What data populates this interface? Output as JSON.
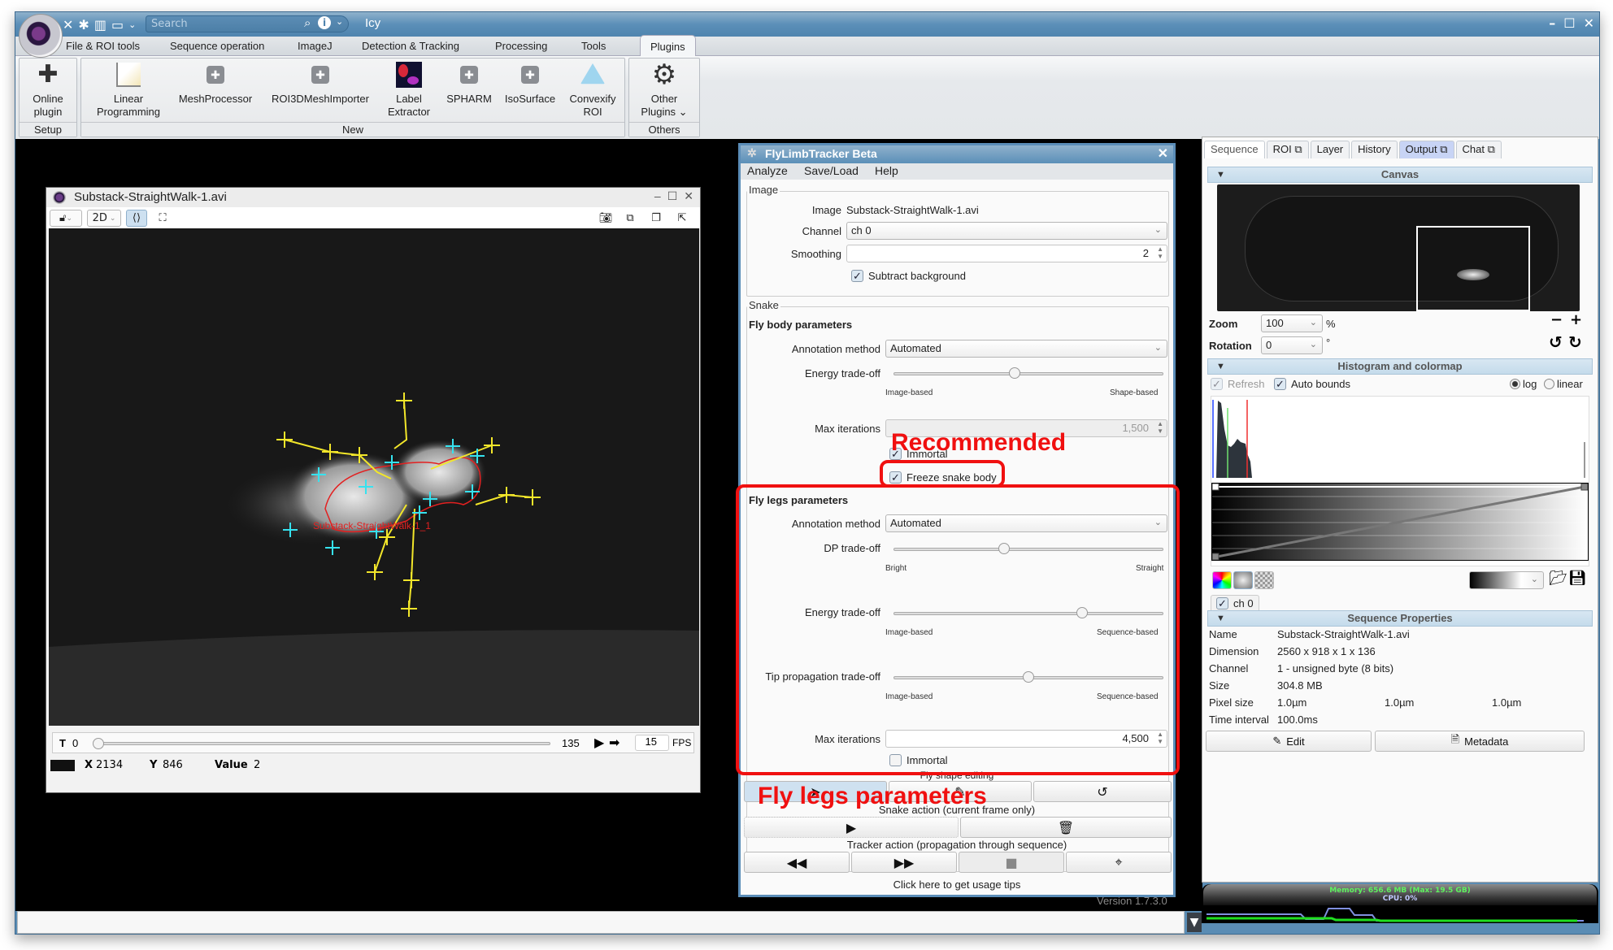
{
  "app": {
    "title": "Icy",
    "search_placeholder": "Search",
    "quick_icons": [
      "tools-icon",
      "plugin-icon",
      "layout-icon",
      "window-icon"
    ],
    "window_controls": [
      "minimize-icon",
      "maximize-icon",
      "close-icon"
    ]
  },
  "menu": {
    "items": [
      "File & ROI tools",
      "Sequence operation",
      "ImageJ",
      "Detection & Tracking",
      "Processing",
      "Tools",
      "Plugins"
    ],
    "active": "Plugins"
  },
  "ribbon": {
    "groups": [
      {
        "label": "Setup",
        "buttons": [
          {
            "label1": "Online",
            "label2": "plugin",
            "icon": "puzzle-icon"
          }
        ]
      },
      {
        "label": "New",
        "buttons": [
          {
            "label1": "Linear",
            "label2": "Programming",
            "icon": "chart-icon"
          },
          {
            "label1": "MeshProcessor",
            "label2": "",
            "icon": "puzzle-icon"
          },
          {
            "label1": "ROI3DMeshImporter",
            "label2": "",
            "icon": "puzzle-icon"
          },
          {
            "label1": "Label",
            "label2": "Extractor",
            "icon": "label-icon"
          },
          {
            "label1": "SPHARM",
            "label2": "",
            "icon": "puzzle-icon"
          },
          {
            "label1": "IsoSurface",
            "label2": "",
            "icon": "puzzle-icon"
          },
          {
            "label1": "Convexify",
            "label2": "ROI",
            "icon": "triangle-icon"
          }
        ]
      },
      {
        "label": "Others",
        "buttons": [
          {
            "label1": "Other",
            "label2": "Plugins ⌄",
            "icon": "gear-icon"
          }
        ]
      }
    ]
  },
  "viewer": {
    "title": "Substack-StraightWalk-1.avi",
    "mode": "2D",
    "roi_label": "Substack-StraightWalk-1_1",
    "t_label": "T",
    "t_value": "0",
    "t_max": "135",
    "t_fraction": 0.0,
    "fps": "15",
    "fps_label": "FPS",
    "x_label": "X",
    "x_value": "2134",
    "y_label": "Y",
    "y_value": "846",
    "value_label": "Value",
    "value": "2"
  },
  "plugin": {
    "title": "FlyLimbTracker Beta",
    "menu": [
      "Analyze",
      "Save/Load",
      "Help"
    ],
    "image_section": {
      "legend": "Image",
      "image_label": "Image",
      "image_value": "Substack-StraightWalk-1.avi",
      "channel_label": "Channel",
      "channel_value": "ch 0",
      "smoothing_label": "Smoothing",
      "smoothing_value": "2",
      "subtract_bg_label": "Subtract background",
      "subtract_bg_checked": true
    },
    "snake_section": {
      "legend": "Snake",
      "body_title": "Fly body parameters",
      "annotation_label": "Annotation method",
      "annotation_value": "Automated",
      "energy_label": "Energy trade-off",
      "energy_left": "Image-based",
      "energy_right": "Shape-based",
      "energy_fraction": 0.45,
      "max_iter_label": "Max iterations",
      "max_iter_value": "1,500",
      "immortal_label": "Immortal",
      "freeze_label": "Freeze snake body",
      "freeze_checked": true
    },
    "legs_section": {
      "title": "Fly legs parameters",
      "annotation_label": "Annotation method",
      "annotation_value": "Automated",
      "dp_label": "DP trade-off",
      "dp_left": "Bright",
      "dp_right": "Straight",
      "dp_fraction": 0.41,
      "energy_label": "Energy trade-off",
      "energy_left": "Image-based",
      "energy_right": "Sequence-based",
      "energy_fraction": 0.7,
      "tip_label": "Tip propagation trade-off",
      "tip_left": "Image-based",
      "tip_right": "Sequence-based",
      "tip_fraction": 0.5,
      "max_iter_label": "Max iterations",
      "max_iter_value": "4,500",
      "immortal_label": "Immortal",
      "immortal_checked": false
    },
    "shape_editing_label": "Fly shape editing",
    "snake_action_label": "Snake action (current frame only)",
    "tracker_action_label": "Tracker action (propagation through sequence)",
    "tips_label": "Click here to get usage tips",
    "version": "Version 1.7.3.0"
  },
  "annotations": {
    "recommended": "Recommended",
    "fly_legs": "Fly legs parameters",
    "color": "#f01010"
  },
  "right_panel": {
    "tabs": [
      "Sequence",
      "ROI",
      "Layer",
      "History",
      "Output",
      "Chat"
    ],
    "canvas": {
      "header": "Canvas",
      "zoom_label": "Zoom",
      "zoom_value": "100",
      "zoom_unit": "%",
      "rotation_label": "Rotation",
      "rotation_value": "0",
      "rotation_unit": "°"
    },
    "histogram": {
      "header": "Histogram and colormap",
      "refresh_label": "Refresh",
      "auto_bounds_label": "Auto bounds",
      "log_label": "log",
      "linear_label": "linear",
      "scale_selected": "log",
      "channel_label": "ch 0"
    },
    "properties": {
      "header": "Sequence Properties",
      "rows": [
        {
          "k": "Name",
          "v": "Substack-StraightWalk-1.avi"
        },
        {
          "k": "Dimension",
          "v": "2560 x 918 x 1 x 136"
        },
        {
          "k": "Channel",
          "v": "1 - unsigned byte (8 bits)"
        },
        {
          "k": "Size",
          "v": "304.8 MB"
        },
        {
          "k": "Pixel size",
          "v": "1.0µm",
          "v2": "1.0µm",
          "v3": "1.0µm"
        },
        {
          "k": "Time interval",
          "v": "100.0ms"
        }
      ],
      "edit_label": "Edit",
      "metadata_label": "Metadata"
    },
    "memory": {
      "memory_text": "Memory: 656.6 MB  (Max: 19.5 GB)",
      "cpu_text": "CPU: 0%"
    }
  }
}
